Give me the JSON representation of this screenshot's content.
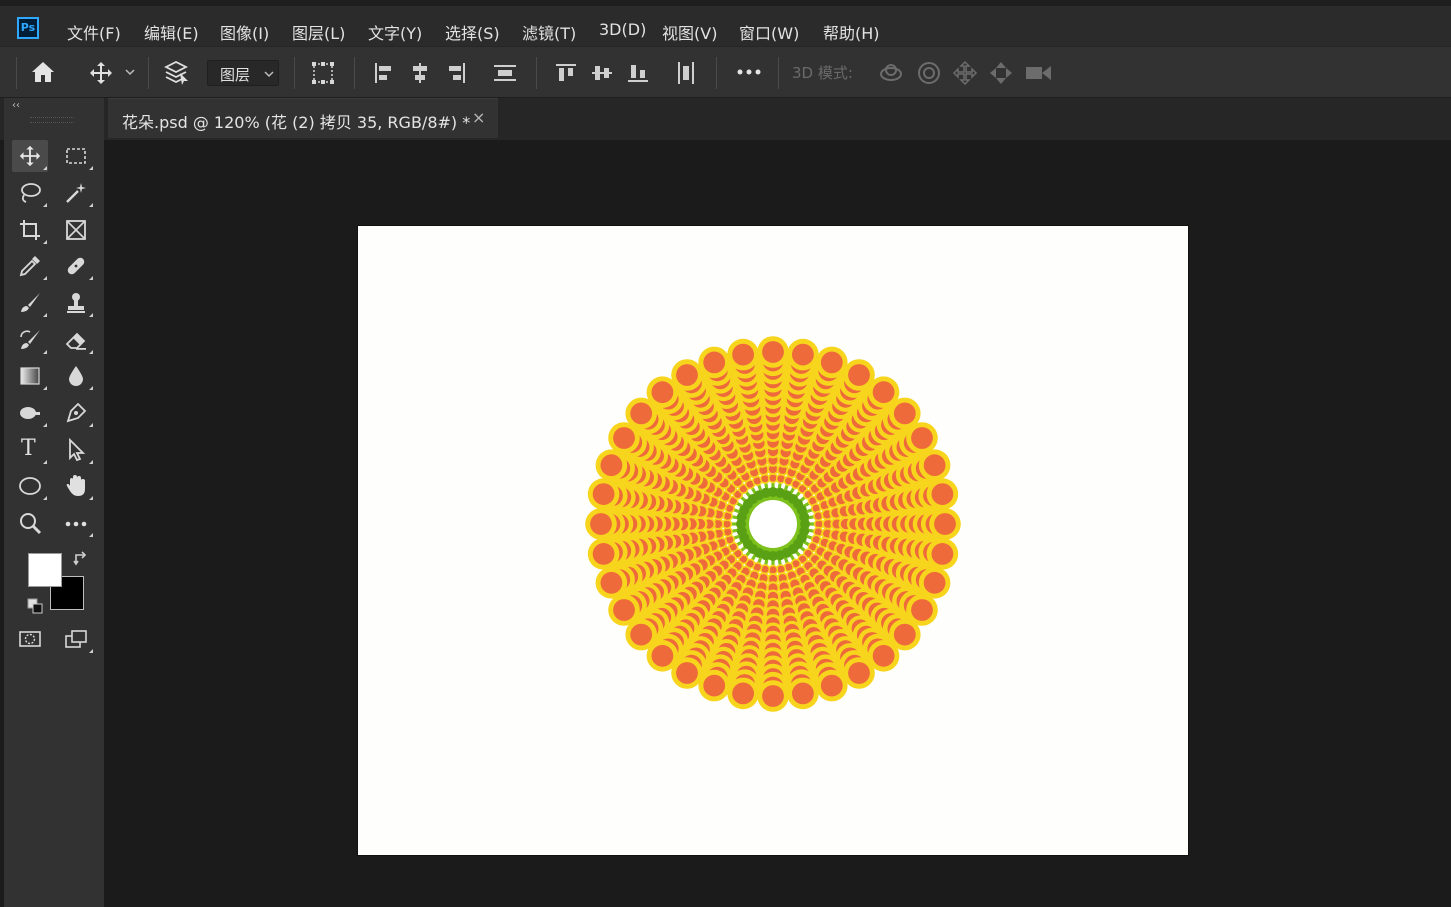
{
  "app": {
    "logo_text": "Ps",
    "accent_color": "#31a8ff"
  },
  "menu": {
    "items": [
      {
        "id": "file",
        "label": "文件(F)"
      },
      {
        "id": "edit",
        "label": "编辑(E)"
      },
      {
        "id": "image",
        "label": "图像(I)"
      },
      {
        "id": "layer",
        "label": "图层(L)"
      },
      {
        "id": "type",
        "label": "文字(Y)"
      },
      {
        "id": "select",
        "label": "选择(S)"
      },
      {
        "id": "filter",
        "label": "滤镜(T)"
      },
      {
        "id": "3d",
        "label": "3D(D)"
      },
      {
        "id": "view",
        "label": "视图(V)"
      },
      {
        "id": "window",
        "label": "窗口(W)"
      },
      {
        "id": "help",
        "label": "帮助(H)"
      }
    ]
  },
  "options_bar": {
    "auto_select_target": "图层",
    "mode_3d_label": "3D 模式:",
    "icons": [
      "home-icon",
      "move-tool-icon",
      "auto-select-layers-icon",
      "transform-controls-icon",
      "align-left-edges-icon",
      "align-horizontal-centers-icon",
      "align-right-edges-icon",
      "distribute-vertical-icon",
      "align-top-edges-icon",
      "align-vertical-centers-icon",
      "align-bottom-edges-icon",
      "distribute-horizontal-icon",
      "more-options-icon",
      "orbit-3d-icon",
      "roll-3d-icon",
      "drag-3d-icon",
      "slide-3d-icon",
      "scale-3d-icon"
    ]
  },
  "document": {
    "tab_title": "花朵.psd @ 120% (花 (2) 拷贝 35, RGB/8#) *",
    "close_glyph": "×"
  },
  "toolbox": {
    "collapse_glyph": "‹‹",
    "tools": [
      "move-tool-icon",
      "rectangular-marquee-icon",
      "lasso-icon",
      "magic-wand-icon",
      "crop-icon",
      "frame-icon",
      "eyedropper-icon",
      "healing-brush-icon",
      "brush-icon",
      "clone-stamp-icon",
      "history-brush-icon",
      "eraser-icon",
      "gradient-icon",
      "blur-icon",
      "dodge-icon",
      "pen-icon",
      "type-tool-icon",
      "path-selection-icon",
      "ellipse-tool-icon",
      "hand-icon",
      "zoom-icon",
      "more-tools-icon"
    ],
    "type_tool_glyph": "T",
    "foreground_color": "#ffffff",
    "background_color": "#000000"
  },
  "canvas": {
    "background_color": "#fefefd",
    "flower_colors": {
      "petal_ring": "#f7d51d",
      "petal_center": "#ee6a3a",
      "stem": "#7cc11c",
      "stem_dark": "#5aa014",
      "center_hole": "#ffffff"
    }
  }
}
